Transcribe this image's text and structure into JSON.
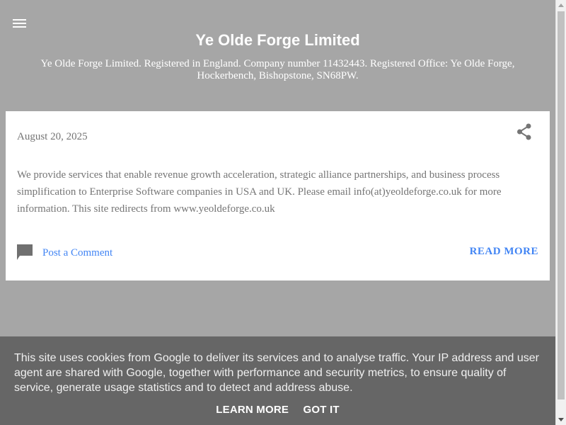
{
  "header": {
    "menu_icon": "hamburger-menu-icon",
    "title": "Ye Olde Forge Limited",
    "description": "Ye Olde Forge Limited. Registered in England. Company number 11432443. Registered Office: Ye Olde Forge, Hockerbench, Bishopstone, SN68PW."
  },
  "post": {
    "date": "August 20, 2025",
    "share_icon": "share-icon",
    "body": "We provide services that enable revenue growth acceleration, strategic alliance partnerships, and business process simplification to Enterprise Software companies in USA and UK. Please email info(at)yeoldeforge.co.uk for more information. This site redirects from www.yeoldeforge.co.uk",
    "comment_icon": "comment-icon",
    "comment_label": "Post a Comment",
    "read_more_label": "READ MORE"
  },
  "cookie_notice": {
    "text": "This site uses cookies from Google to deliver its services and to analyse traffic. Your IP address and user agent are shared with Google, together with performance and security metrics, to ensure quality of service, generate usage statistics and to detect and address abuse.",
    "learn_more_label": "LEARN MORE",
    "got_it_label": "GOT IT"
  },
  "colors": {
    "background": "#a6a6a6",
    "accent": "#4285f4",
    "cookie_bar": "#666666"
  }
}
